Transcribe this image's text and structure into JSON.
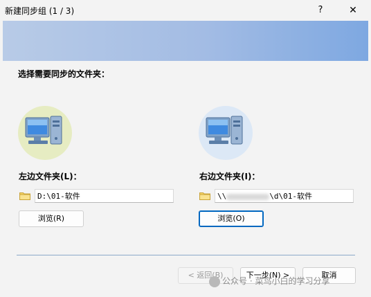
{
  "window": {
    "title": "新建同步组 (1 / 3)",
    "help_icon": "?",
    "close_icon": "✕"
  },
  "page": {
    "heading": "选择需要同步的文件夹："
  },
  "left": {
    "label": "左边文件夹(L)：",
    "path": "D:\\01-软件",
    "browse_label": "浏览(R)"
  },
  "right": {
    "label": "右边文件夹(I)：",
    "path_prefix": "\\\\",
    "path_suffix": "\\d\\01-软件",
    "browse_label": "浏览(O)"
  },
  "footer": {
    "back_label": "< 返回(B)",
    "next_label": "下一步(N) >",
    "cancel_label": "取消"
  },
  "watermark": {
    "text": "公众号 · 菜鸟小白的学习分享"
  },
  "colors": {
    "banner_start": "#b8cbe7",
    "banner_end": "#7ea8e1",
    "focus_border": "#0067c0"
  },
  "icons": [
    "computer-icon",
    "folder-icon",
    "help-icon",
    "close-icon"
  ]
}
